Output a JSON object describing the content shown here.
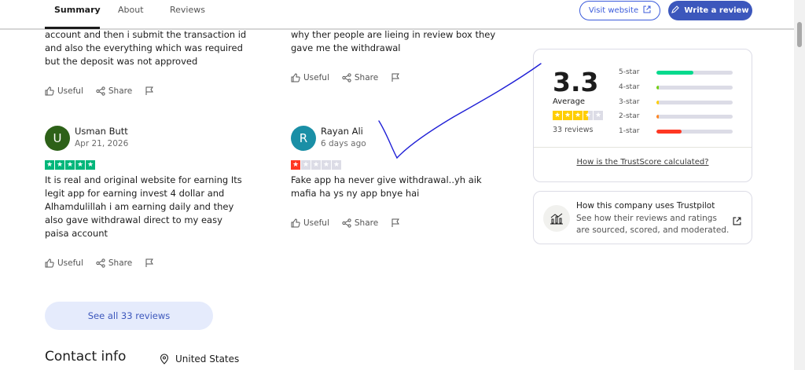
{
  "nav": {
    "tabs": [
      {
        "label": "Summary",
        "active": true
      },
      {
        "label": "About",
        "active": false
      },
      {
        "label": "Reviews",
        "active": false
      }
    ],
    "visit_website": "Visit website",
    "write_review": "Write a review"
  },
  "reviews": {
    "left_top_text": [
      "account and then i submit the transaction id",
      "and also the everything which was required",
      "but the deposit was not approved"
    ],
    "right_top_text": [
      "why ther people are lieing in review box they",
      "gave me the withdrawal"
    ],
    "useful": "Useful",
    "share": "Share",
    "usman": {
      "initial": "U",
      "name": "Usman Butt",
      "date": "Apr 21, 2026",
      "rating": 5,
      "text": [
        "It is real and original website for earning Its",
        "legit app for earning invest 4 dollar and",
        "Alhamdulillah i am earning daily and they",
        "also gave withdrawal direct to my easy",
        "paisa account"
      ]
    },
    "rayan": {
      "initial": "R",
      "name": "Rayan Ali",
      "date": "6 days ago",
      "rating": 1,
      "text": [
        "Fake app ha never give withdrawal..yh aik",
        "mafia ha ys ny app bnye hai"
      ]
    },
    "see_all": "See all 33 reviews"
  },
  "contact": {
    "title": "Contact info",
    "location": "United States"
  },
  "trustscore": {
    "score": "3.3",
    "word": "Average",
    "stars": 3.5,
    "count": "33 reviews",
    "distribution": [
      {
        "label": "5-star",
        "fraction": 0.48,
        "color": "#04da8d"
      },
      {
        "label": "4-star",
        "fraction": 0.03,
        "color": "#73cf11"
      },
      {
        "label": "3-star",
        "fraction": 0.03,
        "color": "#ffce00"
      },
      {
        "label": "2-star",
        "fraction": 0.03,
        "color": "#ff8622"
      },
      {
        "label": "1-star",
        "fraction": 0.33,
        "color": "#ff3722"
      }
    ],
    "calc_link": "How is the TrustScore calculated?"
  },
  "trustpilot_use": {
    "title": "How this company uses Trustpilot",
    "body": "See how their reviews and ratings are sourced, scored, and moderated."
  },
  "colors": {
    "accent": "#3c57bc",
    "five_star_green": "#00b67a",
    "one_star_red": "#ff3722",
    "usman_avatar": "#2d6118",
    "rayan_avatar": "#1a8fa6"
  }
}
